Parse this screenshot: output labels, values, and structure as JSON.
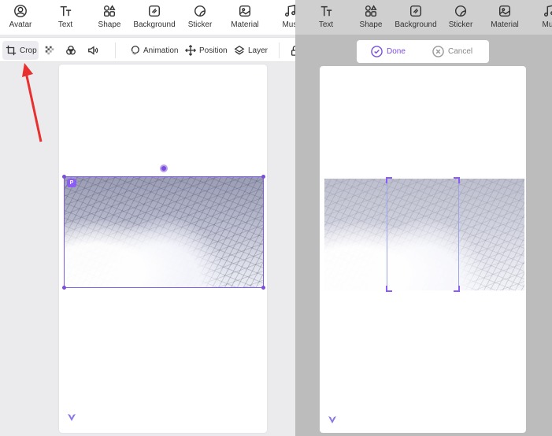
{
  "left_panel": {
    "top_menu": [
      {
        "label": "Avatar",
        "icon": "avatar-icon"
      },
      {
        "label": "Text",
        "icon": "text-icon"
      },
      {
        "label": "Shape",
        "icon": "shape-icon"
      },
      {
        "label": "Background",
        "icon": "background-icon"
      },
      {
        "label": "Sticker",
        "icon": "sticker-icon"
      },
      {
        "label": "Material",
        "icon": "material-icon"
      },
      {
        "label": "Musi",
        "icon": "music-icon"
      }
    ],
    "toolbar": {
      "crop_label": "Crop",
      "mosaic_icon": "mosaic-icon",
      "filter_icon": "filter-icon",
      "sound_icon": "volume-icon",
      "animation_label": "Animation",
      "position_label": "Position",
      "layer_label": "Layer",
      "lock_icon": "lock-icon"
    },
    "annotation": {
      "type": "arrow",
      "color": "#e8302e",
      "points_to": "Crop"
    },
    "canvas": {
      "selected_element": "snowy forest photo",
      "replace_badge": "replace-image-icon"
    }
  },
  "right_panel": {
    "top_menu": [
      {
        "label": "Text",
        "icon": "text-icon"
      },
      {
        "label": "Shape",
        "icon": "shape-icon"
      },
      {
        "label": "Background",
        "icon": "background-icon"
      },
      {
        "label": "Sticker",
        "icon": "sticker-icon"
      },
      {
        "label": "Material",
        "icon": "material-icon"
      },
      {
        "label": "Mus",
        "icon": "music-icon"
      }
    ],
    "confirm_bar": {
      "done_label": "Done",
      "cancel_label": "Cancel"
    },
    "canvas": {
      "mode": "crop"
    }
  },
  "colors": {
    "accent": "#7c4ddb",
    "arrow": "#e8302e",
    "overlay": "#bcbcbc"
  }
}
